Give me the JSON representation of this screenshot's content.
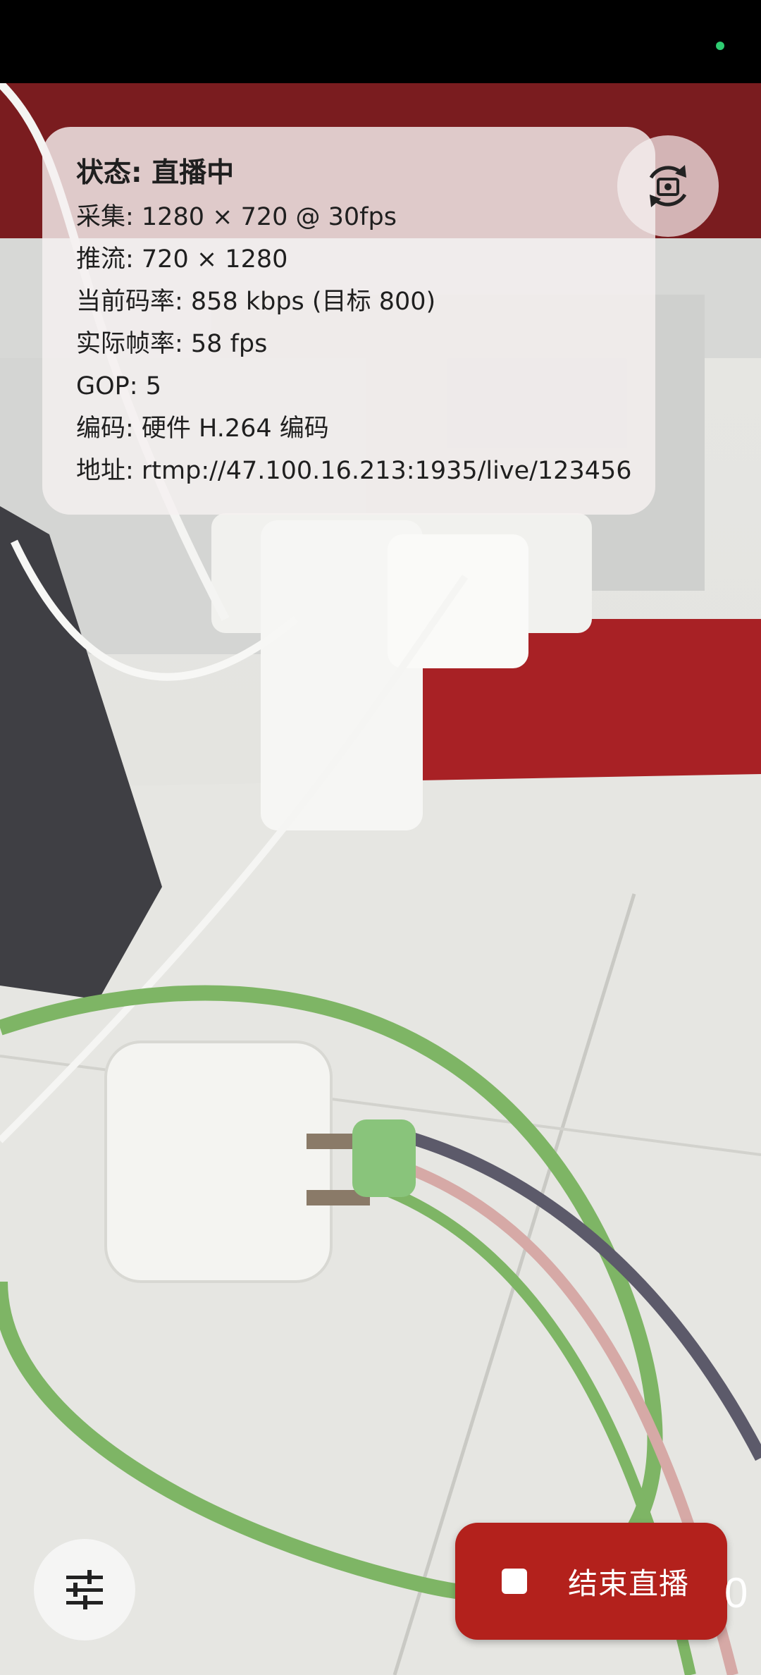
{
  "status": {
    "label": "状态: 直播中",
    "capture": "采集: 1280 × 720 @ 30fps",
    "push": "推流: 720 × 1280",
    "bitrate": "当前码率: 858 kbps (目标 800)",
    "fps": "实际帧率: 58 fps",
    "gop": "GOP: 5",
    "encoder": "编码: 硬件 H.264 编码",
    "url": "地址: rtmp://47.100.16.213:1935/live/123456"
  },
  "controls": {
    "stop_label": "结束直播",
    "edge_text": "0"
  },
  "icons": {
    "flip": "camera-flip-icon",
    "settings": "tune-icon",
    "stop": "stop-icon"
  },
  "colors": {
    "stop_button": "#b3211c",
    "status_dot": "#2ecc71"
  }
}
